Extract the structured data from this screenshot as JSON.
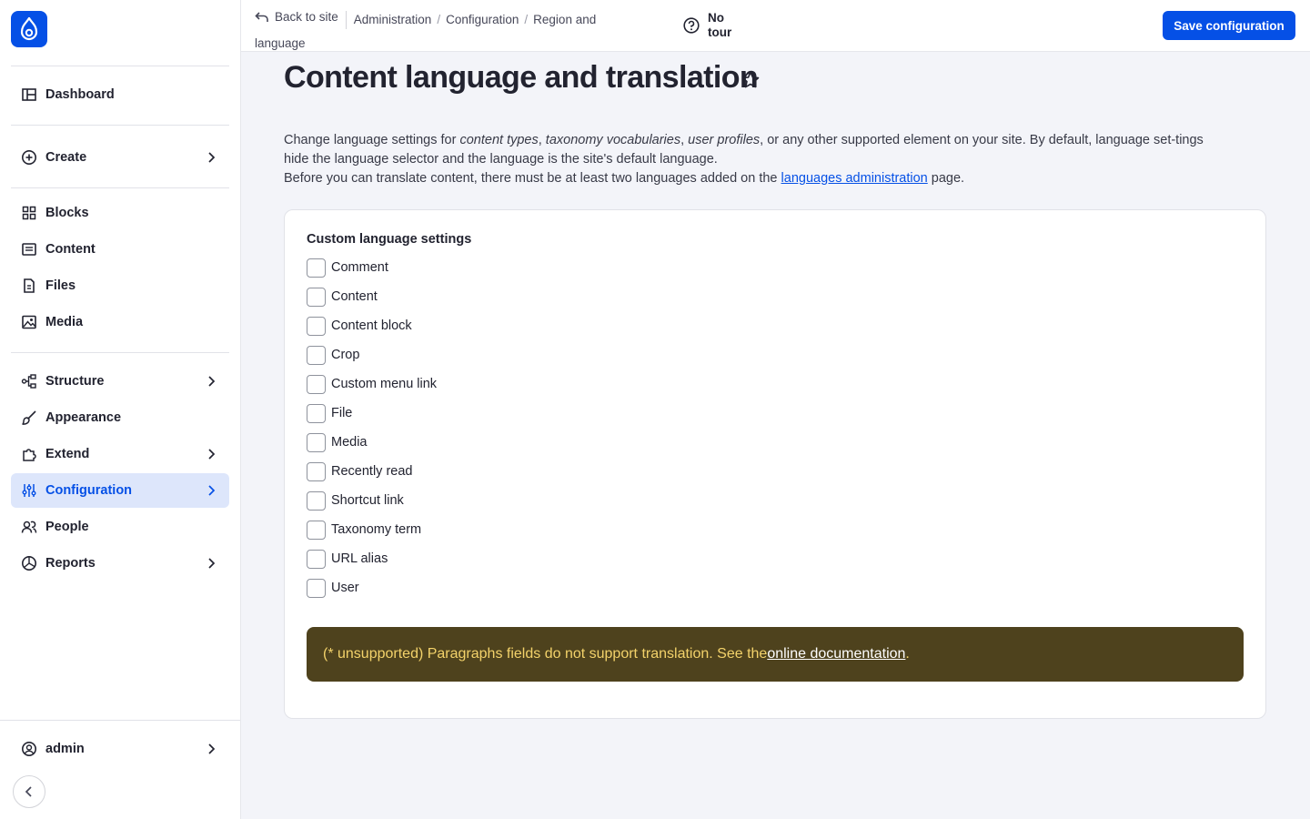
{
  "sidebar": {
    "items": [
      {
        "label": "Dashboard"
      },
      {
        "label": "Create"
      },
      {
        "label": "Blocks"
      },
      {
        "label": "Content"
      },
      {
        "label": "Files"
      },
      {
        "label": "Media"
      },
      {
        "label": "Structure"
      },
      {
        "label": "Appearance"
      },
      {
        "label": "Extend"
      },
      {
        "label": "Configuration"
      },
      {
        "label": "People"
      },
      {
        "label": "Reports"
      }
    ],
    "user": {
      "label": "admin"
    }
  },
  "topbar": {
    "back_label": "Back to site",
    "breadcrumbs": [
      "Administration",
      "Configuration",
      "Region and language"
    ],
    "tour_line1": "No",
    "tour_line2": "tour",
    "save_label": "Save configuration"
  },
  "page": {
    "title": "Content language and translation",
    "desc_p1_a": "Change language settings for ",
    "desc_em1": "content types",
    "desc_p1_b": ", ",
    "desc_em2": "taxonomy vocabularies",
    "desc_p1_c": ", ",
    "desc_em3": "user profiles",
    "desc_p1_d": ", or any other supported element on your site. By default, language set-tings hide the language selector and the language is the site's default language.",
    "desc_p2_a": "Before you can translate content, there must be at least two languages added on the ",
    "desc_p2_link": "languages administration",
    "desc_p2_b": " page."
  },
  "settings": {
    "legend": "Custom language settings",
    "options": [
      {
        "label": "Comment",
        "checked": false
      },
      {
        "label": "Content",
        "checked": false
      },
      {
        "label": "Content block",
        "checked": false
      },
      {
        "label": "Crop",
        "checked": false
      },
      {
        "label": "Custom menu link",
        "checked": false
      },
      {
        "label": "File",
        "checked": false
      },
      {
        "label": "Media",
        "checked": false
      },
      {
        "label": "Recently read",
        "checked": false
      },
      {
        "label": "Shortcut link",
        "checked": false
      },
      {
        "label": "Taxonomy term",
        "checked": false
      },
      {
        "label": "URL alias",
        "checked": false
      },
      {
        "label": "User",
        "checked": false
      }
    ]
  },
  "warning": {
    "text": "(* unsupported) Paragraphs fields do not support translation. See the ",
    "link": "online documentation",
    "end": "."
  },
  "colors": {
    "accent": "#0550e6",
    "warning_bg": "#4e421d",
    "warning_text": "#f3d26a"
  }
}
